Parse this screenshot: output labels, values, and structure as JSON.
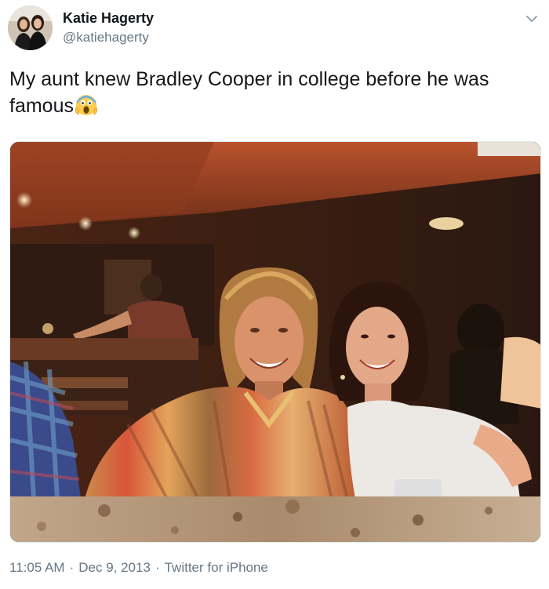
{
  "user": {
    "display_name": "Katie Hagerty",
    "handle": "@katiehagerty",
    "avatar_icon": "profile-photo-two-women"
  },
  "tweet": {
    "text": "My aunt knew Bradley Cooper in college before he was famous",
    "emoji": "screaming-face-emoji",
    "media_description_icon": "photo-icon"
  },
  "footer": {
    "time": "11:05 AM",
    "date": "Dec 9, 2013",
    "client": "Twitter for iPhone",
    "separator": "·"
  },
  "colors": {
    "text": "#14171a",
    "secondary": "#657786",
    "border": "#e1e8ed"
  }
}
